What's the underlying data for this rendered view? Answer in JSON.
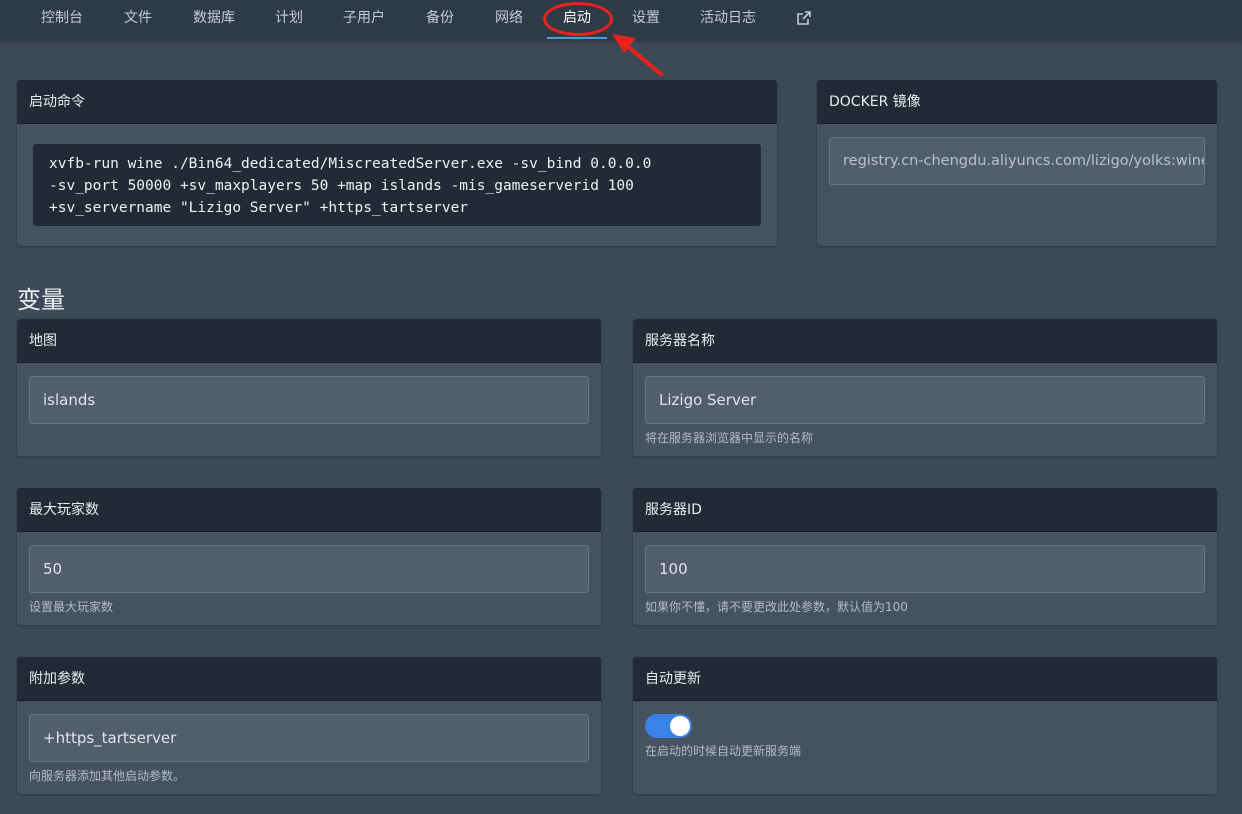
{
  "nav": {
    "items": [
      {
        "label": "控制台"
      },
      {
        "label": "文件"
      },
      {
        "label": "数据库"
      },
      {
        "label": "计划"
      },
      {
        "label": "子用户"
      },
      {
        "label": "备份"
      },
      {
        "label": "网络"
      },
      {
        "label": "启动"
      },
      {
        "label": "设置"
      },
      {
        "label": "活动日志"
      }
    ],
    "active": "启动",
    "external_link_icon": "external-link-icon"
  },
  "startup": {
    "title": "启动命令",
    "command": "xvfb-run wine ./Bin64_dedicated/MiscreatedServer.exe -sv_bind 0.0.0.0\n-sv_port 50000 +sv_maxplayers 50 +map islands -mis_gameserverid 100\n+sv_servername \"Lizigo Server\" +https_tartserver"
  },
  "docker": {
    "title": "DOCKER 镜像",
    "value": "registry.cn-chengdu.aliyuncs.com/lizigo/yolks:wine_latest"
  },
  "variables_title": "变量",
  "variables": {
    "map": {
      "title": "地图",
      "value": "islands",
      "hint": ""
    },
    "server_name": {
      "title": "服务器名称",
      "value": "Lizigo Server",
      "hint": "将在服务器浏览器中显示的名称"
    },
    "max_players": {
      "title": "最大玩家数",
      "value": "50",
      "hint": "设置最大玩家数"
    },
    "server_id": {
      "title": "服务器ID",
      "value": "100",
      "hint": "如果你不懂，请不要更改此处参数，默认值为100"
    },
    "extra_args": {
      "title": "附加参数",
      "value": "+https_tartserver",
      "hint": "向服务器添加其他启动参数。"
    },
    "auto_update": {
      "title": "自动更新",
      "enabled": true,
      "hint": "在启动的时候自动更新服务端"
    }
  },
  "colors": {
    "accent": "#3b82e6",
    "annotation": "#e8231c",
    "header_bg": "#212b35",
    "page_bg": "#3d4956"
  }
}
